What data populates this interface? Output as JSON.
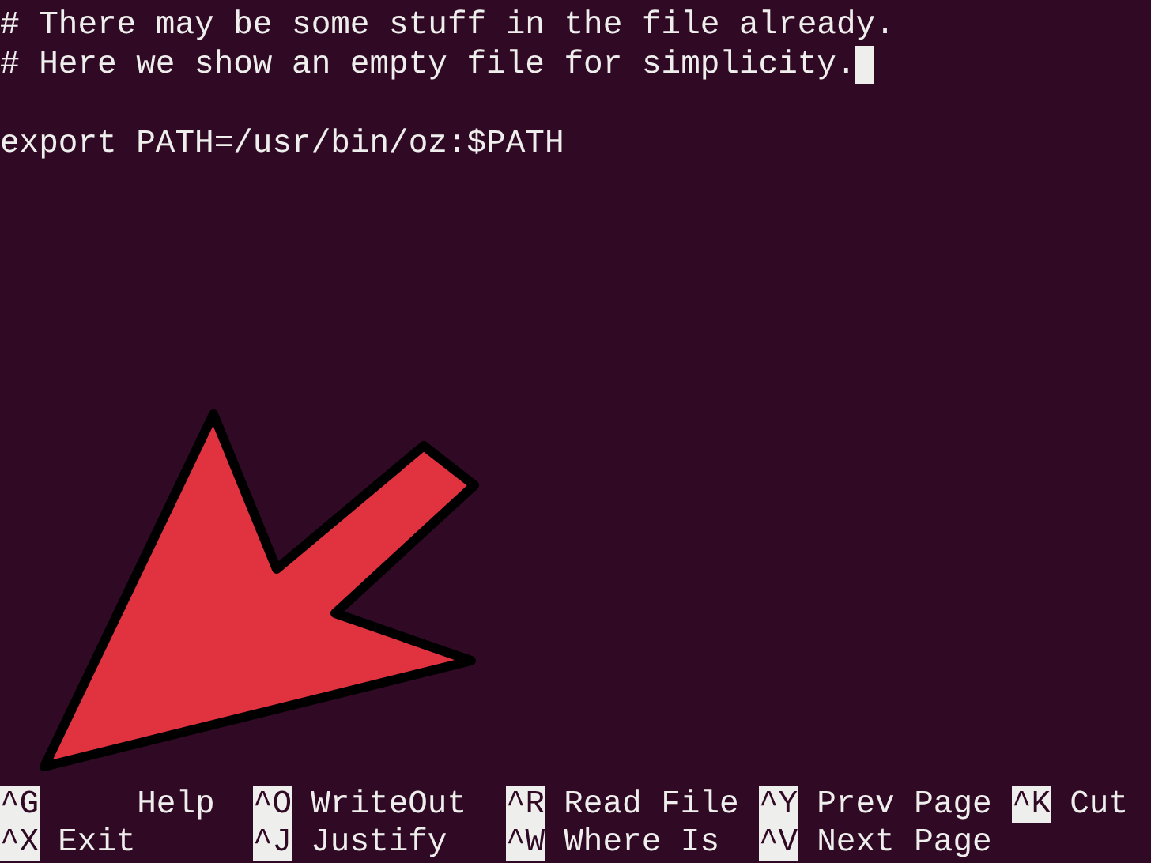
{
  "editor": {
    "paragraphs": [
      [
        "# There may be some stuff in the file already.",
        "# Here we show an empty file for simplicity."
      ],
      [
        "export PATH=/usr/bin/oz:$PATH"
      ]
    ]
  },
  "shortcut_rows": [
    [
      {
        "key": "^G",
        "label": "Help"
      },
      {
        "key": "^O",
        "label": "WriteOut"
      },
      {
        "key": "^R",
        "label": "Read File"
      },
      {
        "key": "^Y",
        "label": "Prev Page"
      },
      {
        "key": "^K",
        "label": "Cut"
      }
    ],
    [
      {
        "key": "^X",
        "label": "Exit"
      },
      {
        "key": "^J",
        "label": "Justify"
      },
      {
        "key": "^W",
        "label": "Where Is"
      },
      {
        "key": "^V",
        "label": "Next Page"
      }
    ]
  ]
}
